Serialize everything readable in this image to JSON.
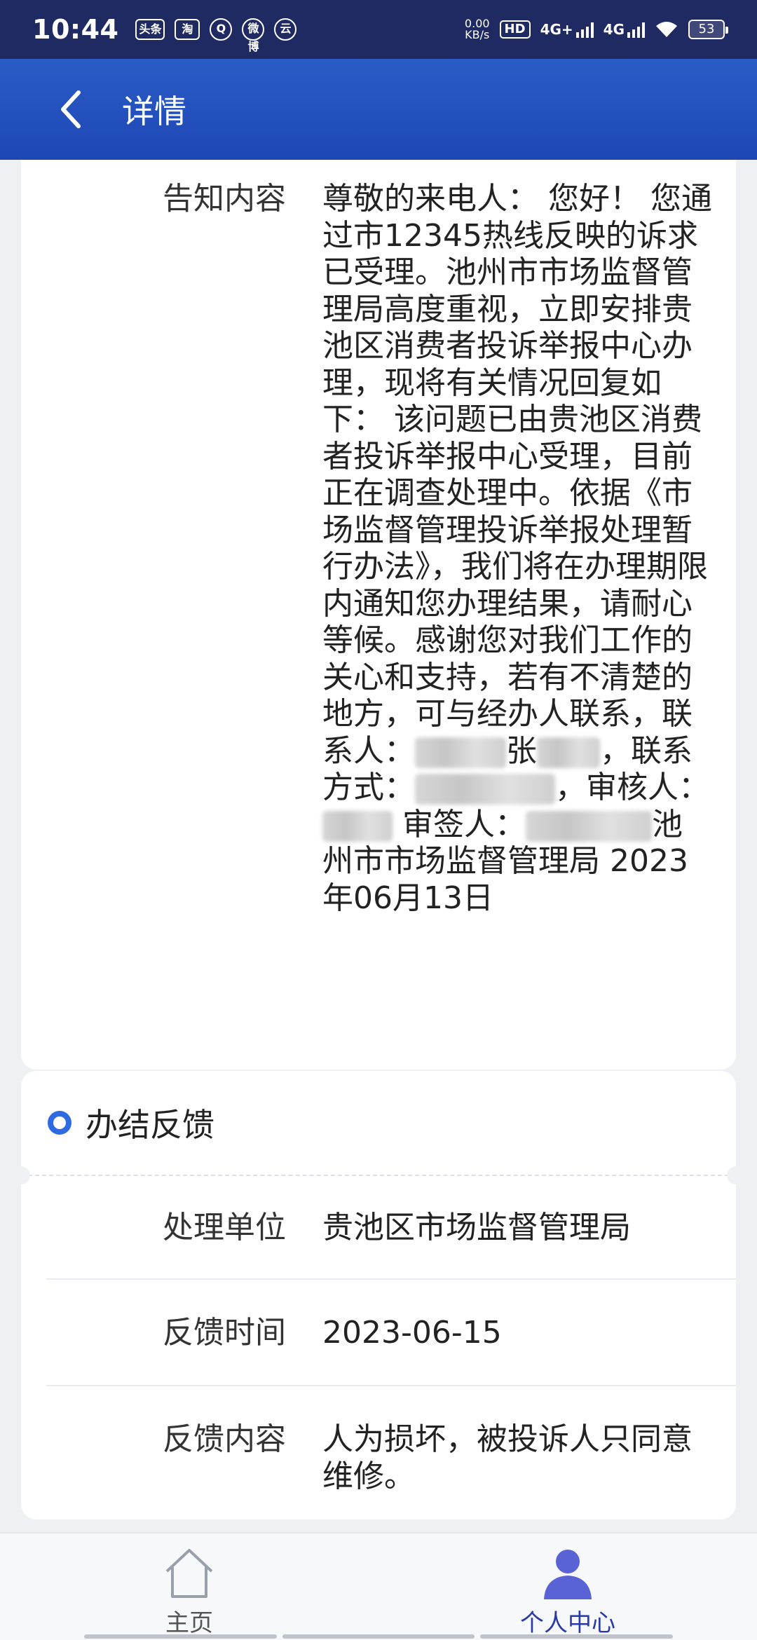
{
  "status_bar": {
    "time": "10:44",
    "apps": [
      "头条",
      "淘",
      "Q",
      "微博",
      "云"
    ],
    "net_speed_value": "0.00",
    "net_speed_unit": "KB/s",
    "hd": "HD",
    "net1": "4G+",
    "net2": "4G",
    "battery": "53"
  },
  "header": {
    "title": "详情"
  },
  "notice": {
    "label": "告知内容",
    "text_part1": "尊敬的来电人： 您好！ 您通过市12345热线反映的诉求已受理。池州市市场监督管理局高度重视，立即安排贵池区消费者投诉举报中心办理，现将有关情况回复如下： 该问题已由贵池区消费者投诉举报中心受理，目前正在调查处理中。依据《市场监督管理投诉举报处理暂行办法》，我们将在办理期限内通知您办理结果，请耐心等候。感谢您对我们工作的关心和支持，若有不清楚的地方，可与经办人联系，联系人：",
    "text_part2": "张",
    "text_part3": "，联系方式：",
    "text_part4": "，审核人：",
    "text_part5": "审签人：",
    "text_part6": "池州市市场监督管理局 2023年06月13日"
  },
  "feedback": {
    "section_title": "办结反馈",
    "rows": [
      {
        "label": "处理单位",
        "value": "贵池区市场监督管理局"
      },
      {
        "label": "反馈时间",
        "value": "2023-06-15"
      },
      {
        "label": "反馈内容",
        "value": "人为损坏，被投诉人只同意维修。"
      }
    ]
  },
  "bottom_nav": {
    "items": [
      {
        "label": "主页"
      },
      {
        "label": "个人中心"
      }
    ]
  },
  "colors": {
    "header_blue": "#2a5cc6",
    "status_navy": "#1f2a63",
    "accent": "#2f6be0",
    "active_nav": "#2a3aa6"
  }
}
